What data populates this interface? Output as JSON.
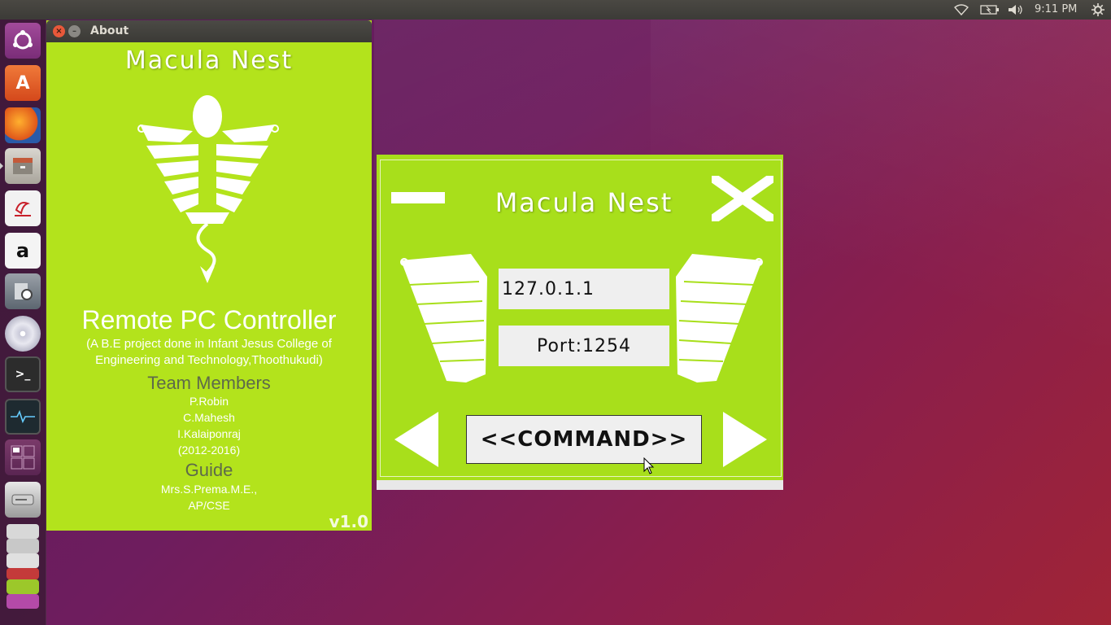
{
  "topbar": {
    "clock": "9:11 PM",
    "indicators": [
      "wifi-icon",
      "battery-icon",
      "volume-icon",
      "settings-gear-icon"
    ]
  },
  "launcher": {
    "items": [
      "ubuntu-dash-icon",
      "software-center-icon",
      "firefox-icon",
      "files-icon",
      "libreoffice-impress-icon",
      "amazon-icon",
      "system-settings-icon",
      "dvd-icon",
      "terminal-icon",
      "system-monitor-icon",
      "workspace-switcher-icon",
      "drive-icon",
      "stacked-windows-icon"
    ]
  },
  "about": {
    "window_title": "About",
    "app_title": "Macula Nest",
    "product": "Remote PC Controller",
    "description": "(A B.E project done in Infant Jesus College of Engineering and Technology,Thoothukudi)",
    "team_heading": "Team Members",
    "members": [
      "P.Robin",
      "C.Mahesh",
      "I.Kalaiponraj"
    ],
    "years": "(2012-2016)",
    "guide_heading": "Guide",
    "guide_name": "Mrs.S.Prema.M.E.,",
    "guide_dept": "AP/CSE",
    "version": "v1.0",
    "colors": {
      "background": "#b3e31c",
      "heading": "#5e6a4a"
    }
  },
  "app": {
    "title": "Macula Nest",
    "ip": "127.0.1.1",
    "port": "Port:1254",
    "command_label": "<<COMMAND>>",
    "colors": {
      "background": "#a8df1b",
      "field": "#efefef"
    }
  }
}
